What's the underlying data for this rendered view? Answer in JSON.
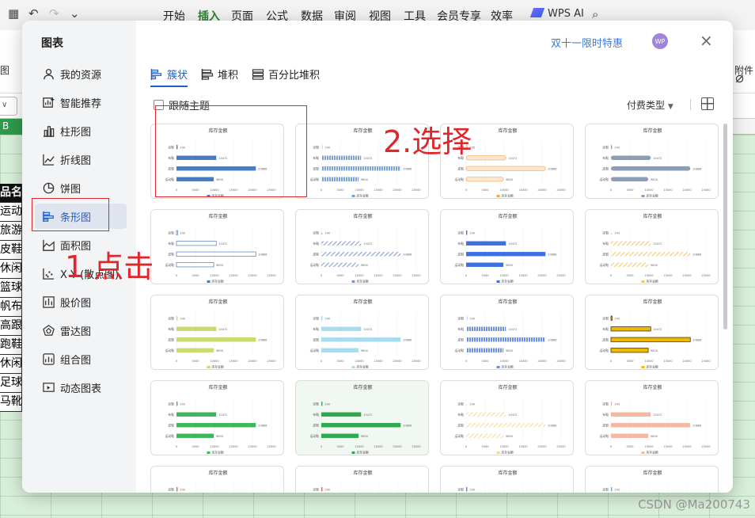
{
  "quick_access": {
    "undo_icon": "↶",
    "redo_icon": "↷",
    "more_icon": "⌄"
  },
  "menu": [
    {
      "label": "开始",
      "active": false
    },
    {
      "label": "插入",
      "active": true
    },
    {
      "label": "页面",
      "active": false
    },
    {
      "label": "公式",
      "active": false
    },
    {
      "label": "数据",
      "active": false
    },
    {
      "label": "审阅",
      "active": false
    },
    {
      "label": "视图",
      "active": false
    },
    {
      "label": "工具",
      "active": false
    },
    {
      "label": "会员专享",
      "active": false
    },
    {
      "label": "效率",
      "active": false
    }
  ],
  "wps_ai": "WPS AI",
  "ribbon": {
    "left_label": "图",
    "right_label": "附件"
  },
  "namebox": "∨",
  "column_b": "B",
  "left_cells": [
    "品名称",
    "运动鞋",
    "旅游鞋",
    "皮鞋",
    "休闲鞋",
    "篮球鞋",
    "帆布鞋",
    "高跟鞋",
    "跑鞋",
    "休闲鞋",
    "足球鞋",
    "马靴"
  ],
  "watermark": "CSDN @Ma200743",
  "dialog": {
    "title": "图表",
    "sidebar": [
      {
        "label": "我的资源",
        "icon": "person-icon"
      },
      {
        "label": "智能推荐",
        "icon": "smart-recommend-icon"
      },
      {
        "label": "柱形图",
        "icon": "column-chart-icon"
      },
      {
        "label": "折线图",
        "icon": "line-chart-icon"
      },
      {
        "label": "饼图",
        "icon": "pie-chart-icon"
      },
      {
        "label": "条形图",
        "icon": "bar-chart-icon",
        "selected": true
      },
      {
        "label": "面积图",
        "icon": "area-chart-icon"
      },
      {
        "label": "X Y (散点图)",
        "icon": "scatter-chart-icon"
      },
      {
        "label": "股价图",
        "icon": "stock-chart-icon"
      },
      {
        "label": "雷达图",
        "icon": "radar-chart-icon"
      },
      {
        "label": "组合图",
        "icon": "combo-chart-icon"
      },
      {
        "label": "动态图表",
        "icon": "dynamic-chart-icon"
      }
    ],
    "promo": "双十一限时特惠",
    "avatar": "WP",
    "close_icon": "×",
    "tabs": [
      {
        "label": "簇状",
        "selected": true
      },
      {
        "label": "堆积",
        "selected": false
      },
      {
        "label": "百分比堆积",
        "selected": false
      }
    ],
    "follow_theme": "跟随主题",
    "pay_type": "付费类型",
    "pay_type_arrow": "▼"
  },
  "thumbnail": {
    "title": "库存金额",
    "legend": "库存金额",
    "categories": [
      "凉鞋",
      "布鞋",
      "皮鞋",
      "运动鞋"
    ],
    "values": [
      290,
      10472,
      20886,
      9800
    ],
    "axis_ticks": [
      "0",
      "5000",
      "10000",
      "15000",
      "20000",
      "25000"
    ],
    "styles": [
      {
        "fill": "#4a7bbf",
        "style": "first"
      },
      {
        "fill": "#7aa0d8",
        "style": "wave"
      },
      {
        "fill": "#f2a65a",
        "style": "capsule"
      },
      {
        "fill": "#8c9db5",
        "style": "thick"
      },
      {
        "fill": "#ffffff",
        "stroke": "#4a7bbf",
        "style": "outline"
      },
      {
        "fill": "#7d96c8",
        "style": "hatch"
      },
      {
        "fill": "#3f6fe0",
        "style": "solid"
      },
      {
        "fill": "#f4c26a",
        "style": "stripe"
      },
      {
        "fill": "#c9da6e",
        "style": "solid"
      },
      {
        "fill": "#a7dbf0",
        "style": "solid"
      },
      {
        "fill": "#6c8ee0",
        "style": "dots"
      },
      {
        "fill": "#f0b800",
        "stroke": "#222222",
        "style": "outline"
      },
      {
        "fill": "#3fb55d",
        "style": "solid"
      },
      {
        "fill": "#2fa84f",
        "style": "solid"
      },
      {
        "fill": "#f4d98a",
        "style": "stripe"
      },
      {
        "fill": "#f4b8a0",
        "style": "solid"
      },
      {
        "fill": "#e06060",
        "style": "solid"
      },
      {
        "fill": "#e06060",
        "style": "solid"
      },
      {
        "fill": "#7c6fd8",
        "style": "solid"
      },
      {
        "fill": "#6aa8e0",
        "style": "solid"
      }
    ]
  },
  "annotations": {
    "step1": "1.点击",
    "step2": "2.选择"
  }
}
